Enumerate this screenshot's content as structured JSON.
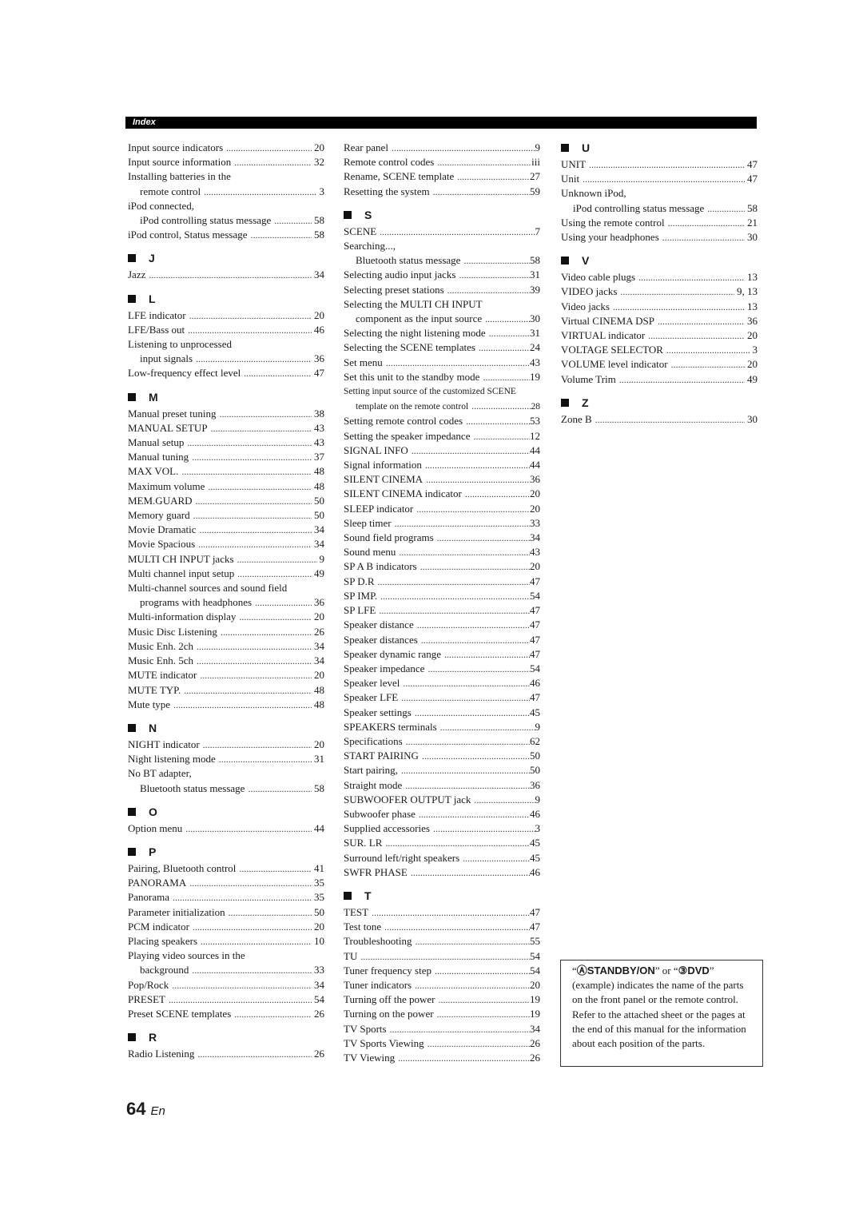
{
  "header": {
    "title": "Index",
    "bar_color": "#000000"
  },
  "columns": [
    {
      "blocks": [
        {
          "letter": null,
          "entries": [
            {
              "label": "Input source indicators",
              "page": "20"
            },
            {
              "label": "Input source information",
              "page": "32"
            },
            {
              "label": "Installing batteries in the",
              "page": null
            },
            {
              "label": "remote control",
              "page": "3",
              "sub": true
            },
            {
              "label": "iPod connected,",
              "page": null
            },
            {
              "label": "iPod controlling status message",
              "page": "58",
              "sub": true
            },
            {
              "label": "iPod control, Status message",
              "page": "58"
            }
          ]
        },
        {
          "letter": "J",
          "entries": [
            {
              "label": "Jazz",
              "page": "34"
            }
          ]
        },
        {
          "letter": "L",
          "entries": [
            {
              "label": "LFE indicator",
              "page": "20"
            },
            {
              "label": "LFE/Bass out",
              "page": "46"
            },
            {
              "label": "Listening to unprocessed",
              "page": null
            },
            {
              "label": "input signals",
              "page": "36",
              "sub": true
            },
            {
              "label": "Low-frequency effect level",
              "page": "47"
            }
          ]
        },
        {
          "letter": "M",
          "entries": [
            {
              "label": "Manual preset tuning",
              "page": "38"
            },
            {
              "label": "MANUAL SETUP",
              "page": "43"
            },
            {
              "label": "Manual setup",
              "page": "43"
            },
            {
              "label": "Manual tuning",
              "page": "37"
            },
            {
              "label": "MAX VOL.",
              "page": "48"
            },
            {
              "label": "Maximum volume",
              "page": "48"
            },
            {
              "label": "MEM.GUARD",
              "page": "50"
            },
            {
              "label": "Memory guard",
              "page": "50"
            },
            {
              "label": "Movie Dramatic",
              "page": "34"
            },
            {
              "label": "Movie Spacious",
              "page": "34"
            },
            {
              "label": "MULTI CH INPUT jacks",
              "page": "9"
            },
            {
              "label": "Multi channel input setup",
              "page": "49"
            },
            {
              "label": "Multi-channel sources and sound field",
              "page": null
            },
            {
              "label": "programs with headphones",
              "page": "36",
              "sub": true
            },
            {
              "label": "Multi-information display",
              "page": "20"
            },
            {
              "label": "Music Disc Listening",
              "page": "26"
            },
            {
              "label": "Music Enh. 2ch",
              "page": "34"
            },
            {
              "label": "Music Enh. 5ch",
              "page": "34"
            },
            {
              "label": "MUTE indicator",
              "page": "20"
            },
            {
              "label": "MUTE TYP.",
              "page": "48"
            },
            {
              "label": "Mute type",
              "page": "48"
            }
          ]
        },
        {
          "letter": "N",
          "entries": [
            {
              "label": "NIGHT indicator",
              "page": "20"
            },
            {
              "label": "Night listening mode",
              "page": "31"
            },
            {
              "label": "No BT adapter,",
              "page": null
            },
            {
              "label": "Bluetooth status message",
              "page": "58",
              "sub": true
            }
          ]
        },
        {
          "letter": "O",
          "entries": [
            {
              "label": "Option menu",
              "page": "44"
            }
          ]
        },
        {
          "letter": "P",
          "entries": [
            {
              "label": "Pairing, Bluetooth control",
              "page": "41"
            },
            {
              "label": "PANORAMA",
              "page": "35"
            },
            {
              "label": "Panorama",
              "page": "35"
            },
            {
              "label": "Parameter initialization",
              "page": "50"
            },
            {
              "label": "PCM indicator",
              "page": "20"
            },
            {
              "label": "Placing speakers",
              "page": "10"
            },
            {
              "label": "Playing video sources in the",
              "page": null
            },
            {
              "label": "background",
              "page": "33",
              "sub": true
            },
            {
              "label": "Pop/Rock",
              "page": "34"
            },
            {
              "label": "PRESET",
              "page": "54"
            },
            {
              "label": "Preset SCENE templates",
              "page": "26"
            }
          ]
        },
        {
          "letter": "R",
          "entries": [
            {
              "label": "Radio Listening",
              "page": "26"
            }
          ]
        }
      ]
    },
    {
      "blocks": [
        {
          "letter": null,
          "entries": [
            {
              "label": "Rear panel",
              "page": "9"
            },
            {
              "label": "Remote control codes",
              "page": "iii"
            },
            {
              "label": "Rename, SCENE template",
              "page": "27"
            },
            {
              "label": "Resetting the system",
              "page": "59"
            }
          ]
        },
        {
          "letter": "S",
          "entries": [
            {
              "label": "SCENE",
              "page": "7"
            },
            {
              "label": "Searching...,",
              "page": null
            },
            {
              "label": "Bluetooth status message",
              "page": "58",
              "sub": true
            },
            {
              "label": "Selecting audio input jacks",
              "page": "31"
            },
            {
              "label": "Selecting preset stations",
              "page": "39"
            },
            {
              "label": "Selecting the MULTI CH INPUT",
              "page": null
            },
            {
              "label": "component as the input source",
              "page": "30",
              "sub": true
            },
            {
              "label": "Selecting the night listening mode",
              "page": "31"
            },
            {
              "label": "Selecting the SCENE templates",
              "page": "24"
            },
            {
              "label": "Set menu",
              "page": "43"
            },
            {
              "label": "Set this unit to the standby mode",
              "page": "19"
            },
            {
              "label": "Setting input source of the customized SCENE",
              "page": null,
              "small": true
            },
            {
              "label": "template on the remote control",
              "page": "28",
              "sub": true,
              "small": true
            },
            {
              "label": "Setting remote control codes",
              "page": "53"
            },
            {
              "label": "Setting the speaker impedance",
              "page": "12"
            },
            {
              "label": "SIGNAL INFO",
              "page": "44"
            },
            {
              "label": "Signal information",
              "page": "44"
            },
            {
              "label": "SILENT CINEMA",
              "page": "36"
            },
            {
              "label": "SILENT CINEMA indicator",
              "page": "20"
            },
            {
              "label": "SLEEP indicator",
              "page": "20"
            },
            {
              "label": "Sleep timer",
              "page": "33"
            },
            {
              "label": "Sound field programs",
              "page": "34"
            },
            {
              "label": "Sound menu",
              "page": "43"
            },
            {
              "label": "SP A B indicators",
              "page": "20"
            },
            {
              "label": "SP D.R",
              "page": "47"
            },
            {
              "label": "SP IMP.",
              "page": "54"
            },
            {
              "label": "SP LFE",
              "page": "47"
            },
            {
              "label": "Speaker distance",
              "page": "47"
            },
            {
              "label": "Speaker distances",
              "page": "47"
            },
            {
              "label": "Speaker dynamic range",
              "page": "47"
            },
            {
              "label": "Speaker impedance",
              "page": "54"
            },
            {
              "label": "Speaker level",
              "page": "46"
            },
            {
              "label": "Speaker LFE",
              "page": "47"
            },
            {
              "label": "Speaker settings",
              "page": "45"
            },
            {
              "label": "SPEAKERS terminals",
              "page": "9"
            },
            {
              "label": "Specifications",
              "page": "62"
            },
            {
              "label": "START PAIRING",
              "page": "50"
            },
            {
              "label": "Start pairing,",
              "page": "50"
            },
            {
              "label": "Straight mode",
              "page": "36"
            },
            {
              "label": "SUBWOOFER OUTPUT jack",
              "page": "9"
            },
            {
              "label": "Subwoofer phase",
              "page": "46"
            },
            {
              "label": "Supplied accessories",
              "page": "3"
            },
            {
              "label": "SUR. LR",
              "page": "45"
            },
            {
              "label": "Surround left/right speakers",
              "page": "45"
            },
            {
              "label": "SWFR PHASE",
              "page": "46"
            }
          ]
        },
        {
          "letter": "T",
          "entries": [
            {
              "label": "TEST",
              "page": "47"
            },
            {
              "label": "Test tone",
              "page": "47"
            },
            {
              "label": "Troubleshooting",
              "page": "55"
            },
            {
              "label": "TU",
              "page": "54"
            },
            {
              "label": "Tuner frequency step",
              "page": "54"
            },
            {
              "label": "Tuner indicators",
              "page": "20"
            },
            {
              "label": "Turning off the power",
              "page": "19"
            },
            {
              "label": "Turning on the power",
              "page": "19"
            },
            {
              "label": "TV Sports",
              "page": "34"
            },
            {
              "label": "TV Sports Viewing",
              "page": "26"
            },
            {
              "label": "TV Viewing",
              "page": "26"
            }
          ]
        }
      ]
    },
    {
      "blocks": [
        {
          "letter": "U",
          "entries": [
            {
              "label": "UNIT",
              "page": "47"
            },
            {
              "label": "Unit",
              "page": "47"
            },
            {
              "label": "Unknown iPod,",
              "page": null
            },
            {
              "label": "iPod controlling status message",
              "page": "58",
              "sub": true
            },
            {
              "label": "Using the remote control",
              "page": "21"
            },
            {
              "label": "Using your headphones",
              "page": "30"
            }
          ]
        },
        {
          "letter": "V",
          "entries": [
            {
              "label": "Video cable plugs",
              "page": "13"
            },
            {
              "label": "VIDEO jacks",
              "page": "9, 13"
            },
            {
              "label": "Video jacks",
              "page": "13"
            },
            {
              "label": "Virtual CINEMA DSP",
              "page": "36"
            },
            {
              "label": "VIRTUAL indicator",
              "page": "20"
            },
            {
              "label": "VOLTAGE SELECTOR",
              "page": "3"
            },
            {
              "label": "VOLUME level indicator",
              "page": "20"
            },
            {
              "label": "Volume Trim",
              "page": "49"
            }
          ]
        },
        {
          "letter": "Z",
          "entries": [
            {
              "label": "Zone B",
              "page": "30"
            }
          ]
        }
      ]
    }
  ],
  "note": {
    "open_quote_1": "“",
    "key_1_symbol": "Ⓐ",
    "key_1_label": "STANDBY/ON",
    "middle": "” or “",
    "key_2_symbol": "③",
    "key_2_label": "DVD",
    "close_quote": "”",
    "body": "(example) indicates the name of the parts on the front panel or the remote control. Refer to the attached sheet or the pages at the end of this manual for the information about each position of the parts."
  },
  "footer": {
    "page_number": "64",
    "language": "En"
  }
}
